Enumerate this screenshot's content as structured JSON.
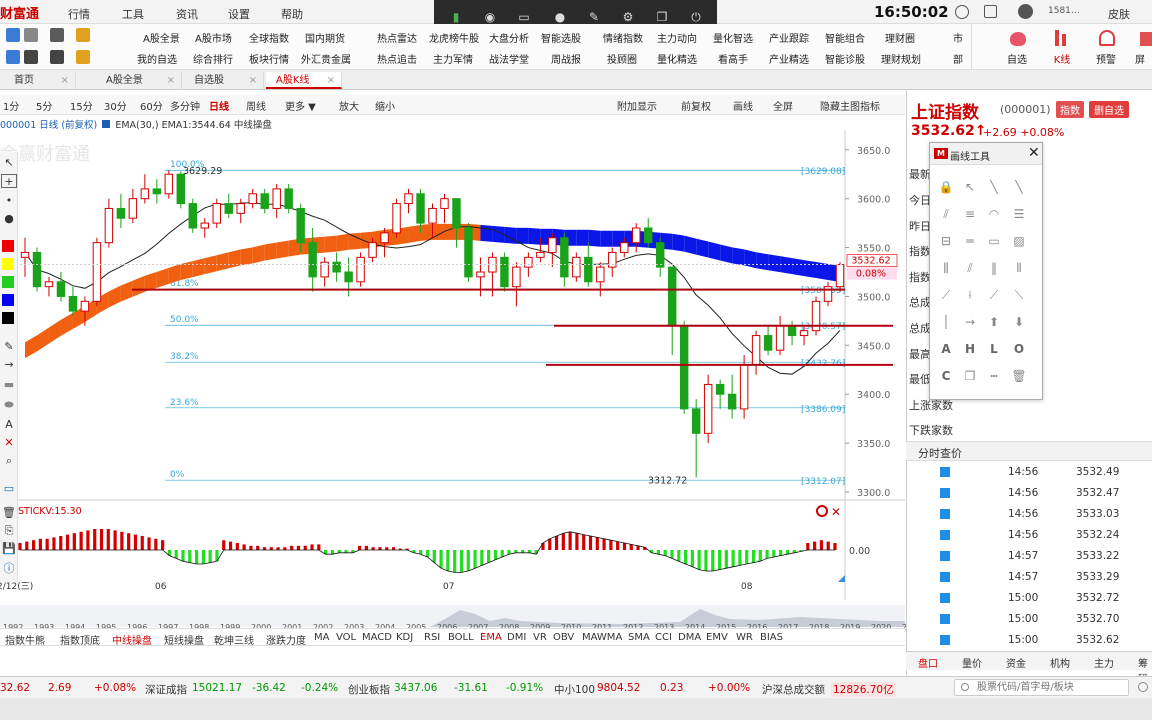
{
  "app": {
    "logo": "财富通",
    "clock": "16:50:02",
    "user_id": "1581…",
    "skin": "皮肤"
  },
  "menu": [
    "行情",
    "工具",
    "资讯",
    "设置",
    "帮助"
  ],
  "toolbar": {
    "row1": [
      "A股全景",
      "A股市场",
      "全球指数",
      "国内期货",
      "热点雷达",
      "龙虎榜牛股",
      "大盘分析",
      "智能选股",
      "情绪指数",
      "主力动向",
      "量化智选",
      "产业跟踪",
      "智能组合",
      "理财圈"
    ],
    "row2": [
      "我的自选",
      "综合排行",
      "板块行情",
      "外汇贵金属",
      "热点追击",
      "主力军情",
      "战法学堂",
      "周战报",
      "投顾圈",
      "量化精选",
      "看高手",
      "产业精选",
      "智能诊股",
      "理财规划"
    ],
    "right": [
      "自选",
      "K线",
      "预警",
      "屏"
    ],
    "partial": [
      "市",
      "部"
    ]
  },
  "tabs": [
    {
      "label": "首页",
      "active": false
    },
    {
      "label": "A股全景",
      "active": false
    },
    {
      "label": "自选股",
      "active": false
    },
    {
      "label": "A股K线",
      "active": true
    }
  ],
  "periods": {
    "buttons": [
      "1分",
      "5分",
      "15分",
      "30分",
      "60分",
      "多分钟",
      "日线",
      "周线",
      "更多 ▼",
      "放大",
      "缩小"
    ],
    "active": "日线",
    "right_buttons": [
      "附加显示",
      "前复权",
      "画线",
      "全屏",
      "隐藏主图指标"
    ]
  },
  "chart_title": {
    "code": "000001 日线",
    "adj": "(前复权)",
    "ema": "EMA(30,)",
    "ema_value": "EMA1:3544.64",
    "ema_desc": "中线操盘"
  },
  "watermark": "金赢财富通",
  "chart_data": {
    "type": "candlestick",
    "series_name": "上证指数 日线",
    "ylim": [
      3300,
      3660
    ],
    "y_ticks": [
      3300,
      3350,
      3400,
      3450,
      3500,
      3550,
      3600,
      3650
    ],
    "y_tick_labels": [
      "3300.0",
      "3350.0",
      "3400.0",
      "3450.0",
      "3500.0",
      "3550.0",
      "3600.0",
      "3650.0"
    ],
    "fib_levels": [
      {
        "label": "100.0%",
        "value": 3629.08
      },
      {
        "label": "61.8%",
        "value": 3507.59
      },
      {
        "label": "50.0%",
        "value": 3470.57
      },
      {
        "label": "38.2%",
        "value": 3432.76
      },
      {
        "label": "23.6%",
        "value": 3386.09
      },
      {
        "label": "0%",
        "value": 3312.07
      }
    ],
    "fib_value_labels": [
      "[3629.08]",
      "[3507.59]",
      "[3470.57]",
      "[3432.76]",
      "[3386.09]",
      "[3312.07]"
    ],
    "high_label": "3629.29",
    "low_label": "3312.72",
    "last_price": "3532.62",
    "last_pct": "0.08%",
    "horizontal_lines": [
      3507,
      3470,
      3430
    ],
    "x_labels": [
      "06",
      "07",
      "08"
    ],
    "left_date_label": "2/12(三)",
    "ohlc": [
      [
        3540,
        3560,
        3520,
        3545
      ],
      [
        3545,
        3550,
        3505,
        3510
      ],
      [
        3510,
        3520,
        3500,
        3515
      ],
      [
        3515,
        3525,
        3495,
        3500
      ],
      [
        3500,
        3510,
        3480,
        3485
      ],
      [
        3485,
        3500,
        3470,
        3495
      ],
      [
        3495,
        3560,
        3490,
        3555
      ],
      [
        3555,
        3600,
        3550,
        3590
      ],
      [
        3590,
        3605,
        3570,
        3580
      ],
      [
        3580,
        3610,
        3575,
        3600
      ],
      [
        3600,
        3625,
        3595,
        3610
      ],
      [
        3610,
        3620,
        3595,
        3605
      ],
      [
        3605,
        3629,
        3600,
        3625
      ],
      [
        3625,
        3628,
        3590,
        3595
      ],
      [
        3595,
        3600,
        3565,
        3570
      ],
      [
        3570,
        3580,
        3560,
        3575
      ],
      [
        3575,
        3600,
        3570,
        3595
      ],
      [
        3595,
        3605,
        3580,
        3585
      ],
      [
        3585,
        3600,
        3575,
        3595
      ],
      [
        3595,
        3610,
        3590,
        3605
      ],
      [
        3605,
        3610,
        3585,
        3590
      ],
      [
        3590,
        3615,
        3580,
        3610
      ],
      [
        3610,
        3615,
        3585,
        3590
      ],
      [
        3590,
        3595,
        3545,
        3555
      ],
      [
        3555,
        3570,
        3505,
        3520
      ],
      [
        3520,
        3540,
        3510,
        3535
      ],
      [
        3535,
        3545,
        3515,
        3525
      ],
      [
        3525,
        3540,
        3500,
        3515
      ],
      [
        3515,
        3545,
        3510,
        3540
      ],
      [
        3540,
        3560,
        3535,
        3555
      ],
      [
        3555,
        3570,
        3540,
        3565
      ],
      [
        3565,
        3600,
        3560,
        3595
      ],
      [
        3595,
        3610,
        3585,
        3605
      ],
      [
        3605,
        3610,
        3565,
        3575
      ],
      [
        3575,
        3595,
        3560,
        3590
      ],
      [
        3590,
        3605,
        3575,
        3600
      ],
      [
        3600,
        3590,
        3550,
        3570
      ],
      [
        3570,
        3575,
        3515,
        3520
      ],
      [
        3520,
        3540,
        3500,
        3525
      ],
      [
        3525,
        3545,
        3500,
        3540
      ],
      [
        3540,
        3545,
        3505,
        3510
      ],
      [
        3510,
        3535,
        3490,
        3530
      ],
      [
        3530,
        3545,
        3520,
        3540
      ],
      [
        3540,
        3560,
        3535,
        3545
      ],
      [
        3545,
        3565,
        3530,
        3560
      ],
      [
        3560,
        3565,
        3510,
        3520
      ],
      [
        3520,
        3545,
        3515,
        3540
      ],
      [
        3540,
        3555,
        3510,
        3515
      ],
      [
        3515,
        3535,
        3500,
        3530
      ],
      [
        3530,
        3550,
        3520,
        3545
      ],
      [
        3545,
        3560,
        3540,
        3555
      ],
      [
        3555,
        3575,
        3545,
        3570
      ],
      [
        3570,
        3580,
        3550,
        3555
      ],
      [
        3555,
        3560,
        3520,
        3530
      ],
      [
        3530,
        3470,
        3440,
        3470
      ],
      [
        3470,
        3475,
        3380,
        3385
      ],
      [
        3385,
        3395,
        3315,
        3360
      ],
      [
        3360,
        3420,
        3350,
        3410
      ],
      [
        3410,
        3415,
        3385,
        3400
      ],
      [
        3400,
        3420,
        3375,
        3385
      ],
      [
        3385,
        3440,
        3375,
        3430
      ],
      [
        3430,
        3465,
        3420,
        3460
      ],
      [
        3460,
        3470,
        3440,
        3445
      ],
      [
        3445,
        3480,
        3440,
        3470
      ],
      [
        3470,
        3475,
        3450,
        3460
      ],
      [
        3460,
        3470,
        3450,
        3465
      ],
      [
        3465,
        3500,
        3460,
        3495
      ],
      [
        3495,
        3515,
        3490,
        3510
      ],
      [
        3510,
        3535,
        3505,
        3532.62
      ]
    ],
    "ema_band": [
      3445,
      3452,
      3460,
      3468,
      3475,
      3482,
      3490,
      3497,
      3503,
      3508,
      3513,
      3517,
      3521,
      3525,
      3528,
      3531,
      3534,
      3537,
      3540,
      3542,
      3545,
      3547,
      3549,
      3551,
      3552,
      3553,
      3554,
      3556,
      3557,
      3558,
      3560,
      3561,
      3563,
      3565,
      3566,
      3566,
      3566,
      3566,
      3565,
      3564,
      3563,
      3562,
      3562,
      3561,
      3561,
      3560,
      3560,
      3560,
      3559,
      3559,
      3559,
      3559,
      3558,
      3557,
      3556,
      3554,
      3551,
      3548,
      3545,
      3542,
      3540,
      3537,
      3535,
      3533,
      3531,
      3529,
      3527,
      3525,
      3523
    ],
    "indicator": {
      "name": "STICKV:15.30",
      "zero_label": "0.00",
      "values": [
        5,
        6,
        7,
        8,
        8,
        9,
        10,
        11,
        12,
        13,
        14,
        15,
        15,
        15,
        14,
        13,
        12,
        11,
        10,
        9,
        8,
        7,
        -4,
        -6,
        -8,
        -9,
        -10,
        -10,
        -9,
        -8,
        7,
        6,
        5,
        4,
        3,
        3,
        2,
        2,
        2,
        2,
        3,
        3,
        3,
        4,
        4,
        -3,
        -3,
        -2,
        -2,
        -2,
        3,
        3,
        2,
        2,
        2,
        2,
        1,
        1,
        -2,
        -3,
        -5,
        -9,
        -13,
        -15,
        -16,
        -16,
        -15,
        -13,
        -11,
        -9,
        -7,
        -5,
        -3,
        -2,
        -2,
        -2,
        -3,
        5,
        8,
        10,
        12,
        13,
        12,
        11,
        10,
        9,
        8,
        7,
        6,
        5,
        4,
        3,
        2,
        -2,
        -3,
        -4,
        -6,
        -8,
        -10,
        -12,
        -14,
        -15,
        -15,
        -14,
        -13,
        -12,
        -11,
        -10,
        -9,
        -8,
        -6,
        -5,
        -4,
        -3,
        -2,
        -1,
        5,
        6,
        7,
        6,
        5
      ]
    }
  },
  "year_axis": [
    "1992",
    "1993",
    "1994",
    "1995",
    "1996",
    "1997",
    "1998",
    "1999",
    "2000",
    "2001",
    "2002",
    "2003",
    "2004",
    "2005",
    "2006",
    "2007",
    "2008",
    "2009",
    "2010",
    "2011",
    "2012",
    "2013",
    "2014",
    "2015",
    "2016",
    "2017",
    "2018",
    "2019",
    "2020",
    "2021"
  ],
  "indicator_tabs": {
    "items": [
      "指数牛熊",
      "指数顶底",
      "中线操盘",
      "短线操盘",
      "乾坤三线",
      "涨跌力度",
      "MA",
      "VOL",
      "MACD",
      "KDJ",
      "RSI",
      "BOLL",
      "EMA",
      "DMI",
      "VR",
      "OBV",
      "MAWMA",
      "SMA",
      "CCI",
      "DMA",
      "EMV",
      "WR",
      "BIAS"
    ],
    "active": [
      "中线操盘",
      "EMA"
    ]
  },
  "quote": {
    "name": "上证指数",
    "code": "(000001)",
    "badge": "指数",
    "add_button": "删自选",
    "price": "3532.62",
    "arrow": "↑",
    "change": "+2.69",
    "pct": "+0.08%"
  },
  "quote_rows": [
    "最新",
    "今日",
    "昨日",
    "指数",
    "指数",
    "总成",
    "总成",
    "最高",
    "最低",
    "上涨家数",
    "下跌家数"
  ],
  "draw_panel": {
    "title": "画线工具",
    "close": "✕"
  },
  "timesales": {
    "title": "分时查价",
    "rows": [
      {
        "time": "14:56",
        "price": "3532.49"
      },
      {
        "time": "14:56",
        "price": "3532.47"
      },
      {
        "time": "14:56",
        "price": "3533.03"
      },
      {
        "time": "14:56",
        "price": "3532.24"
      },
      {
        "time": "14:57",
        "price": "3533.22"
      },
      {
        "time": "14:57",
        "price": "3533.29"
      },
      {
        "time": "15:00",
        "price": "3532.72"
      },
      {
        "time": "15:00",
        "price": "3532.70"
      },
      {
        "time": "15:00",
        "price": "3532.62"
      }
    ]
  },
  "right_tabs": {
    "items": [
      "盘口",
      "量价",
      "资金",
      "机构",
      "主力",
      "筹码"
    ],
    "active": "盘口"
  },
  "status": {
    "sh_last": "32.62",
    "sh_chg": "2.69",
    "sh_pct": "+0.08%",
    "sz_name": "深证成指",
    "sz_val": "15021.17",
    "sz_chg": "-36.42",
    "sz_pct": "-0.24%",
    "cy_name": "创业板指",
    "cy_val": "3437.06",
    "cy_chg": "-31.61",
    "cy_pct": "-0.91%",
    "zx_name": "中小100",
    "zx_val": "9804.52",
    "zx_chg": "0.23",
    "zx_pct": "+0.00%",
    "total_name": "沪深总成交额",
    "total_val": "12826.70亿",
    "search_placeholder": "股票代码/首字母/板块"
  },
  "colors": {
    "up": "#d40000",
    "down": "#1aa21a",
    "ema_up": "#f06010",
    "ema_down": "#0a17e8",
    "fib": "#36a9d6",
    "hline": "#b00010"
  }
}
